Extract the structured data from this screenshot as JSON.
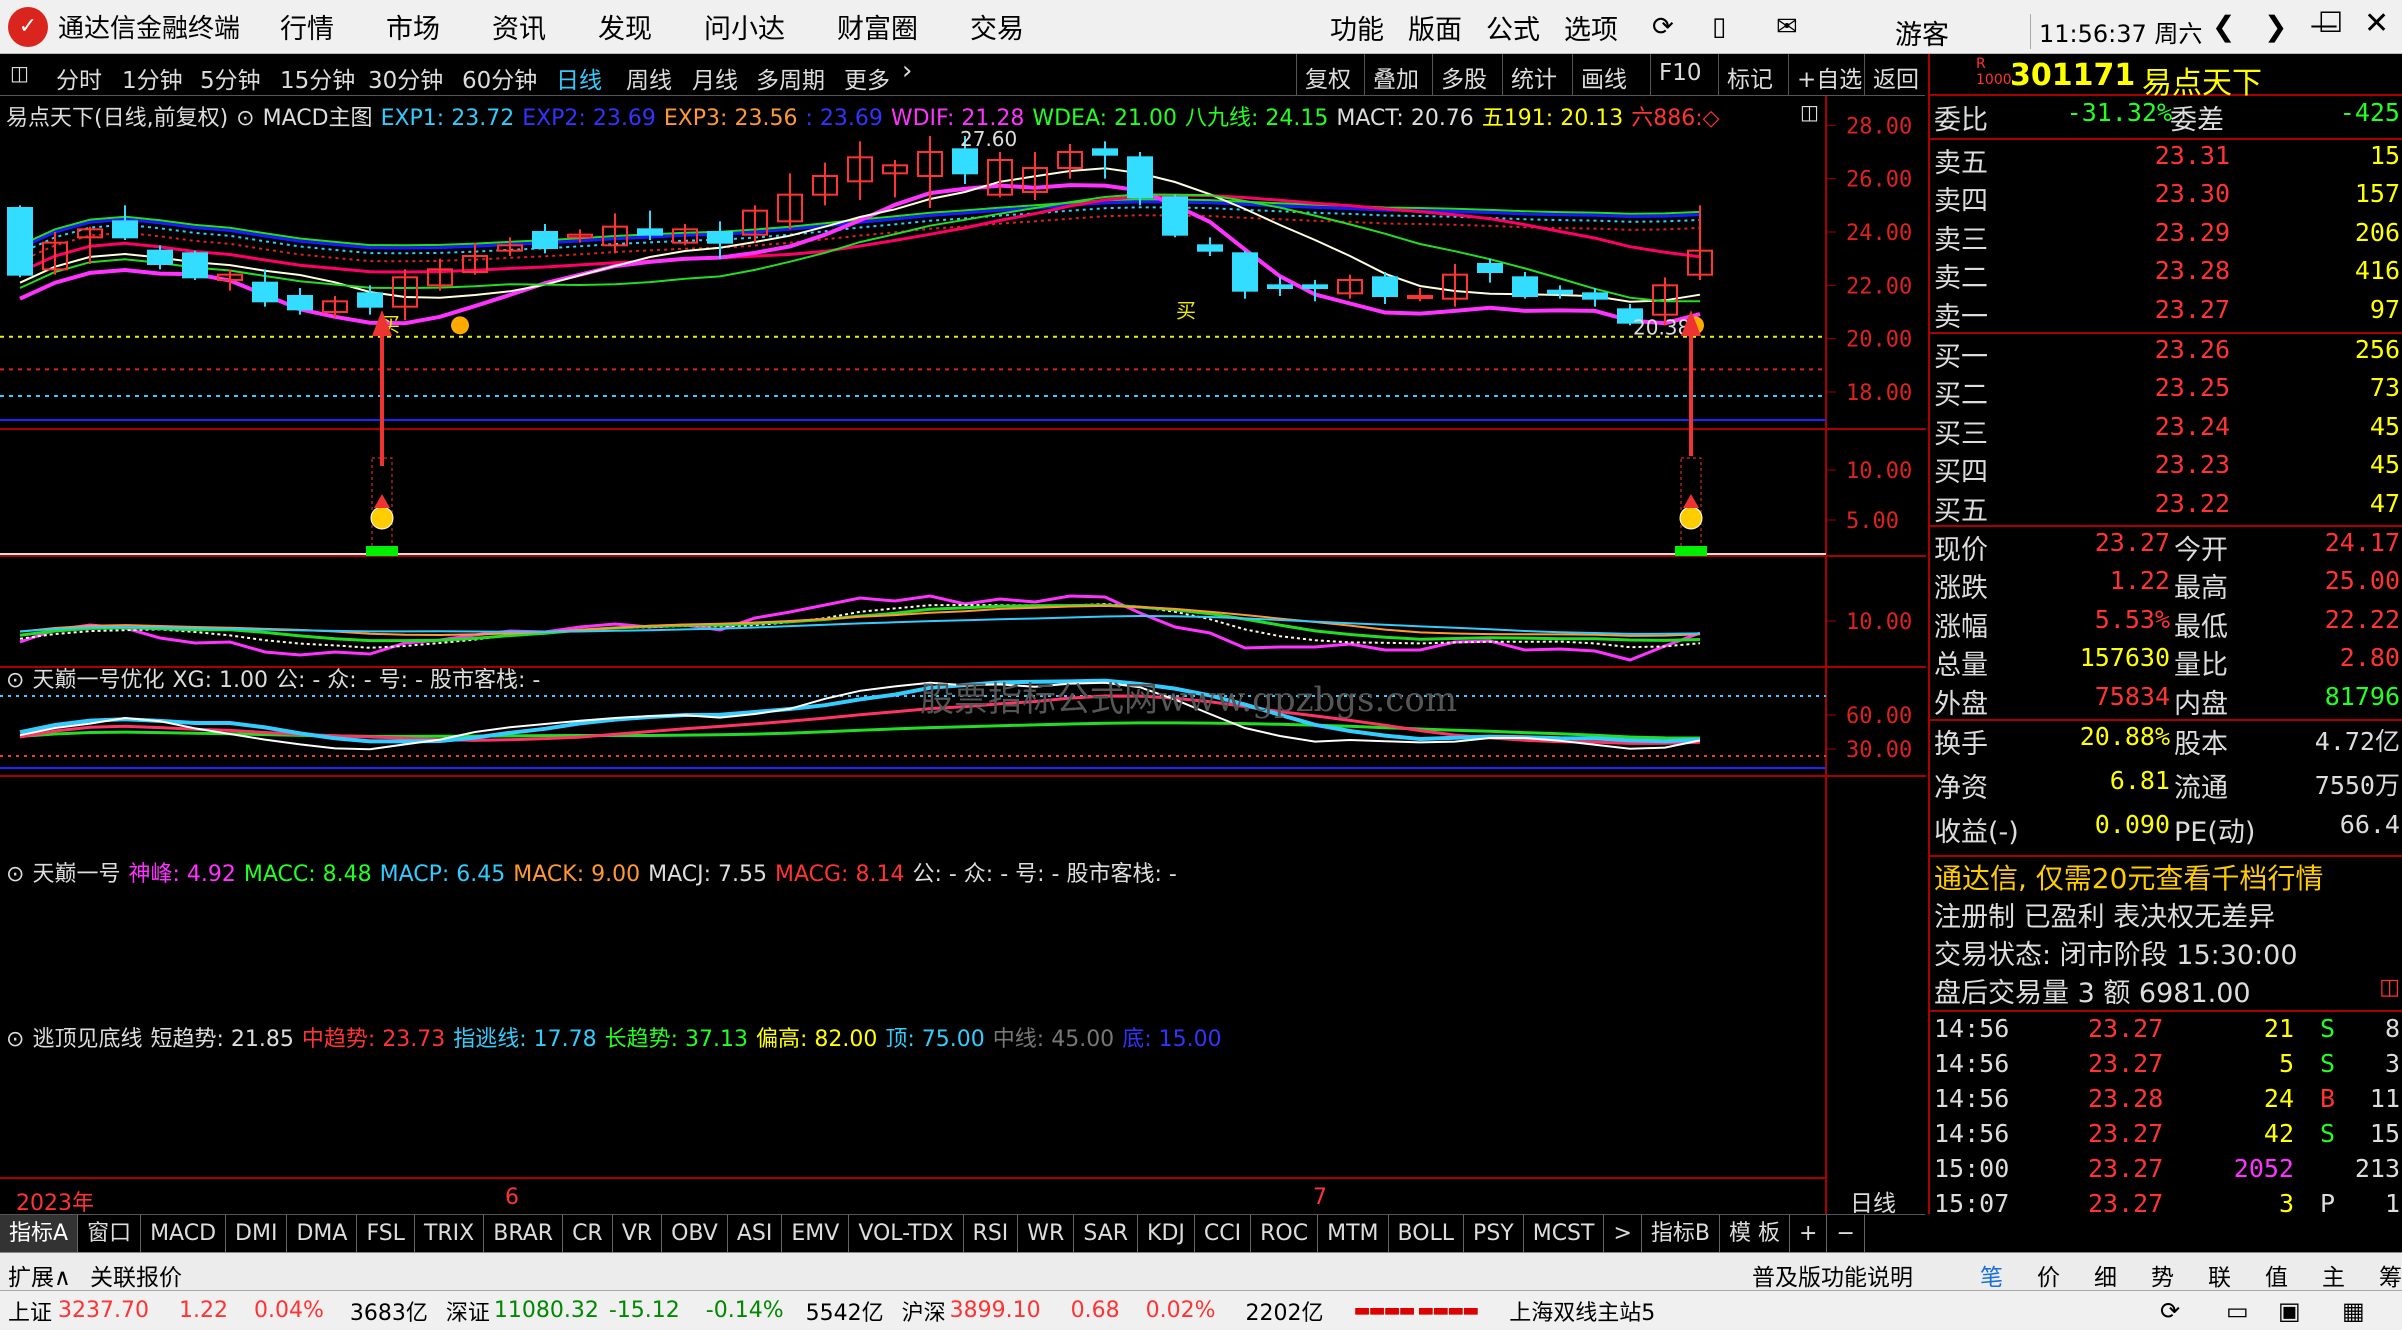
{
  "titlebar": {
    "app_name": "通达信金融终端",
    "menus": [
      "行情",
      "市场",
      "资讯",
      "发现",
      "问小达",
      "财富圈",
      "交易"
    ],
    "right_menus": [
      "功能",
      "版面",
      "公式",
      "选项"
    ],
    "guest": "游客",
    "clock": "11:56:37 周六"
  },
  "timebar": {
    "items": [
      "分时",
      "1分钟",
      "5分钟",
      "15分钟",
      "30分钟",
      "60分钟",
      "日线",
      "周线",
      "月线",
      "多周期",
      "更多"
    ],
    "active": "日线",
    "tools": [
      "复权",
      "叠加",
      "多股",
      "统计",
      "画线",
      "F10",
      "标记",
      "+自选",
      "返回"
    ]
  },
  "main_legend": {
    "name": "易点天下(日线,前复权)",
    "indicator": "MACD主图",
    "exp1": "EXP1: 23.72",
    "exp2": "EXP2: 23.69",
    "exp3": "EXP3: 23.56",
    "extra": ": 23.69",
    "wdif": "WDIF: 21.28",
    "wdea": "WDEA: 21.00",
    "bj": "八九线: 24.15",
    "mact": "MACT: 20.76",
    "w191": "五191: 20.13",
    "l886": "六886:◇"
  },
  "main_axis": [
    "28.00",
    "26.00",
    "24.00",
    "22.00",
    "20.00",
    "18.00"
  ],
  "peak_label": "27.60",
  "low_label": "20.38",
  "buy1": "买",
  "buy2": "买",
  "panel2": {
    "title": "天巅一号优化",
    "xg": "XG: 1.00",
    "rest": "公: -  众: -  号: -  股市客栈: -",
    "axis": [
      "10.00",
      "5.00"
    ],
    "watermark": "股票指标公式网www.gpzbgs.com"
  },
  "panel3": {
    "title": "天巅一号",
    "shen": "神峰: 4.92",
    "macc": "MACC: 8.48",
    "macp": "MACP: 6.45",
    "mack": "MACK: 9.00",
    "macj": "MACJ: 7.55",
    "macg": "MACG: 8.14",
    "rest": "公: -  众: -  号: -  股市客栈: -",
    "axis": [
      "10.00"
    ]
  },
  "panel4": {
    "title": "逃顶见底线",
    "short": "短趋势: 21.85",
    "mid": "中趋势: 23.73",
    "esc": "指逃线: 17.78",
    "long": "长趋势: 37.13",
    "pg": "偏高: 82.00",
    "top": "顶: 75.00",
    "zx": "中线: 45.00",
    "bottom": "底: 15.00",
    "axis": [
      "60.00",
      "30.00"
    ]
  },
  "date_axis": {
    "labels": [
      "2023年",
      "6",
      "7"
    ],
    "mode": "日线"
  },
  "bottom_tabs": [
    "指标A",
    "窗口",
    "MACD",
    "DMI",
    "DMA",
    "FSL",
    "TRIX",
    "BRAR",
    "CR",
    "VR",
    "OBV",
    "ASI",
    "EMV",
    "VOL-TDX",
    "RSI",
    "WR",
    "SAR",
    "KDJ",
    "CCI",
    "ROC",
    "MTM",
    "BOLL",
    "PSY",
    "MCST",
    ">",
    "指标B",
    "模 板",
    "+",
    "−"
  ],
  "bar2": {
    "left": [
      "扩展∧",
      "关联报价"
    ],
    "right": [
      "普及版功能说明",
      "笔",
      "价",
      "细",
      "势",
      "联",
      "值",
      "主",
      "筹"
    ]
  },
  "status": {
    "sh_name": "上证",
    "sh_val": "3237.70",
    "sh_chg": "1.22",
    "sh_pct": "0.04%",
    "sh_amt": "3683亿",
    "sz_name": "深证",
    "sz_val": "11080.32",
    "sz_chg": "-15.12",
    "sz_pct": "-0.14%",
    "sz_amt": "5542亿",
    "hs_name": "沪深",
    "hs_val": "3899.10",
    "hs_chg": "0.68",
    "hs_pct": "0.02%",
    "hs_amt": "2202亿",
    "server": "上海双线主站5"
  },
  "quote": {
    "code": "301171",
    "name": "易点天下",
    "wb_label": "委比",
    "wb": "-31.32%",
    "wc_label": "委差",
    "wc": "-425",
    "asks": [
      {
        "l": "卖五",
        "p": "23.31",
        "v": "15"
      },
      {
        "l": "卖四",
        "p": "23.30",
        "v": "157"
      },
      {
        "l": "卖三",
        "p": "23.29",
        "v": "206"
      },
      {
        "l": "卖二",
        "p": "23.28",
        "v": "416"
      },
      {
        "l": "卖一",
        "p": "23.27",
        "v": "97"
      }
    ],
    "bids": [
      {
        "l": "买一",
        "p": "23.26",
        "v": "256"
      },
      {
        "l": "买二",
        "p": "23.25",
        "v": "73"
      },
      {
        "l": "买三",
        "p": "23.24",
        "v": "45"
      },
      {
        "l": "买四",
        "p": "23.23",
        "v": "45"
      },
      {
        "l": "买五",
        "p": "23.22",
        "v": "47"
      }
    ],
    "stats": [
      {
        "a": "现价",
        "b": "23.27",
        "c": "今开",
        "d": "24.17"
      },
      {
        "a": "涨跌",
        "b": "1.22",
        "c": "最高",
        "d": "25.00"
      },
      {
        "a": "涨幅",
        "b": "5.53%",
        "c": "最低",
        "d": "22.22"
      },
      {
        "a": "总量",
        "b": "157630",
        "c": "量比",
        "d": "2.80"
      },
      {
        "a": "外盘",
        "b": "75834",
        "c": "内盘",
        "d": "81796"
      }
    ],
    "stats2": [
      {
        "a": "换手",
        "b": "20.88%",
        "c": "股本",
        "d": "4.72亿"
      },
      {
        "a": "净资",
        "b": "6.81",
        "c": "流通",
        "d": "7550万"
      },
      {
        "a": "收益(-)",
        "b": "0.090",
        "c": "PE(动)",
        "d": "66.4"
      }
    ],
    "ad": "通达信, 仅需20元查看千档行情",
    "notice": "注册制 已盈利 表决权无差异",
    "trade_status": "交易状态: 闭市阶段 15:30:00",
    "after": "盘后交易量 3 额 6981.00",
    "ticks": [
      {
        "t": "14:56",
        "p": "23.27",
        "v": "21",
        "s": "S",
        "n": "8"
      },
      {
        "t": "14:56",
        "p": "23.27",
        "v": "5",
        "s": "S",
        "n": "3"
      },
      {
        "t": "14:56",
        "p": "23.28",
        "v": "24",
        "s": "B",
        "n": "11"
      },
      {
        "t": "14:56",
        "p": "23.27",
        "v": "42",
        "s": "S",
        "n": "15"
      },
      {
        "t": "15:00",
        "p": "23.27",
        "v": "2052",
        "s": "",
        "n": "213"
      },
      {
        "t": "15:07",
        "p": "23.27",
        "v": "3",
        "s": "P",
        "n": "1"
      }
    ]
  },
  "chart_data": {
    "type": "candlestick",
    "title": "易点天下(日线,前复权)",
    "ylim": [
      16.5,
      28.8
    ],
    "axis_ticks": [
      28,
      26,
      24,
      22,
      20,
      18
    ],
    "candles": [
      [
        24.9,
        22.4,
        25.0,
        22.3
      ],
      [
        22.6,
        23.6,
        24.0,
        22.4
      ],
      [
        23.8,
        24.1,
        24.2,
        22.8
      ],
      [
        24.4,
        23.8,
        25.0,
        23.7
      ],
      [
        23.3,
        22.8,
        23.5,
        22.6
      ],
      [
        23.2,
        22.3,
        23.3,
        22.2
      ],
      [
        22.2,
        22.4,
        22.6,
        21.8
      ],
      [
        22.1,
        21.4,
        22.6,
        21.2
      ],
      [
        21.6,
        21.1,
        21.9,
        20.9
      ],
      [
        21.0,
        21.4,
        21.6,
        20.8
      ],
      [
        21.7,
        21.2,
        22.0,
        20.9
      ],
      [
        21.2,
        22.3,
        22.6,
        20.7
      ],
      [
        22.0,
        22.6,
        23.0,
        21.8
      ],
      [
        22.5,
        23.1,
        23.6,
        22.4
      ],
      [
        23.3,
        23.5,
        23.8,
        23.1
      ],
      [
        24.0,
        23.4,
        24.3,
        23.2
      ],
      [
        23.8,
        23.9,
        24.1,
        23.6
      ],
      [
        23.5,
        24.2,
        24.7,
        23.2
      ],
      [
        24.1,
        23.9,
        24.8,
        23.7
      ],
      [
        23.6,
        24.1,
        24.3,
        23.5
      ],
      [
        24.0,
        23.6,
        24.4,
        23.0
      ],
      [
        23.9,
        24.8,
        25.0,
        23.6
      ],
      [
        24.4,
        25.4,
        26.2,
        24.1
      ],
      [
        25.4,
        26.1,
        26.6,
        25.0
      ],
      [
        25.9,
        26.8,
        27.4,
        25.2
      ],
      [
        26.2,
        26.5,
        26.7,
        25.3
      ],
      [
        26.1,
        27.0,
        27.6,
        24.9
      ],
      [
        27.1,
        26.2,
        27.6,
        25.8
      ],
      [
        25.4,
        26.7,
        27.0,
        25.3
      ],
      [
        25.5,
        26.4,
        27.0,
        25.2
      ],
      [
        26.4,
        27.0,
        27.3,
        26.0
      ],
      [
        27.1,
        26.9,
        27.4,
        26.0
      ],
      [
        26.8,
        25.3,
        27.0,
        25.0
      ],
      [
        25.3,
        23.9,
        25.4,
        23.8
      ],
      [
        23.5,
        23.3,
        23.8,
        23.1
      ],
      [
        23.2,
        21.8,
        23.3,
        21.5
      ],
      [
        22.0,
        21.9,
        22.3,
        21.6
      ],
      [
        22.0,
        21.9,
        22.2,
        21.4
      ],
      [
        21.7,
        22.2,
        22.4,
        21.5
      ],
      [
        22.3,
        21.6,
        22.5,
        21.3
      ],
      [
        21.6,
        21.6,
        21.9,
        21.4
      ],
      [
        21.5,
        22.4,
        22.8,
        21.2
      ],
      [
        22.8,
        22.5,
        23.0,
        22.1
      ],
      [
        22.3,
        21.6,
        22.5,
        21.5
      ],
      [
        21.8,
        21.7,
        22.0,
        21.5
      ],
      [
        21.7,
        21.5,
        21.9,
        21.2
      ],
      [
        21.1,
        20.6,
        21.3,
        20.5
      ],
      [
        20.9,
        22.0,
        22.3,
        20.5
      ],
      [
        22.4,
        23.3,
        25.0,
        22.2
      ]
    ],
    "yellow_dashed": 20.07,
    "red_dashed": 18.85,
    "cyan_dashed": 17.85,
    "blue_line": 16.95
  }
}
